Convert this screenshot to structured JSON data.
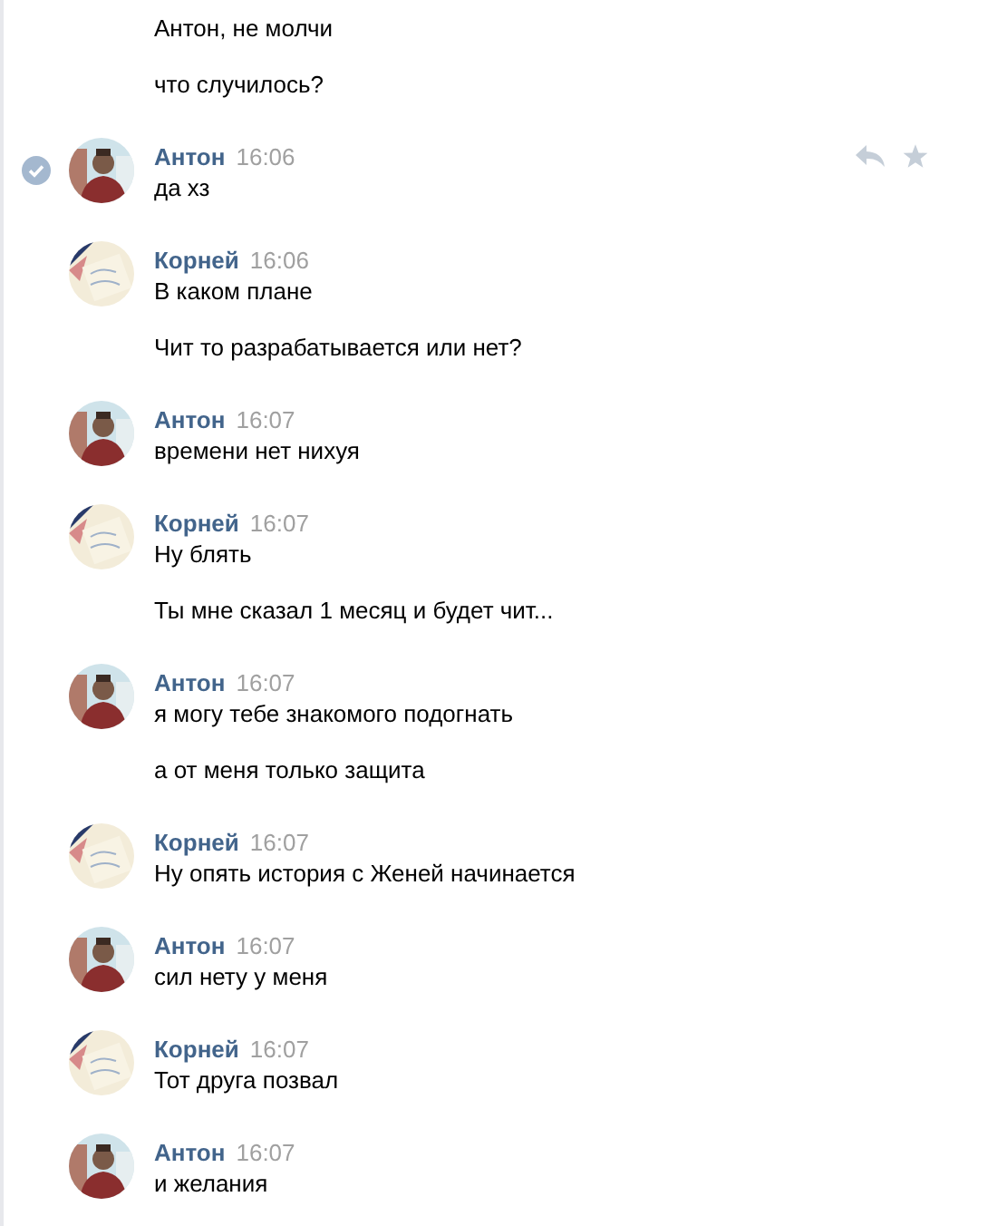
{
  "continuation": [
    "Антон, не молчи",
    "что случилось?"
  ],
  "groups": [
    {
      "author": "Антон",
      "time": "16:06",
      "selected": true,
      "messages": [
        "да хз"
      ]
    },
    {
      "author": "Корней",
      "time": "16:06",
      "selected": false,
      "messages": [
        "В каком плане",
        "Чит то разрабатывается или нет?"
      ]
    },
    {
      "author": "Антон",
      "time": "16:07",
      "selected": false,
      "messages": [
        "времени нет нихуя"
      ]
    },
    {
      "author": "Корней",
      "time": "16:07",
      "selected": false,
      "messages": [
        "Ну блять",
        "Ты мне сказал 1 месяц и будет чит..."
      ]
    },
    {
      "author": "Антон",
      "time": "16:07",
      "selected": false,
      "messages": [
        "я могу тебе знакомого подогнать",
        "а от меня только защита"
      ]
    },
    {
      "author": "Корней",
      "time": "16:07",
      "selected": false,
      "messages": [
        "Ну опять история с Женей начинается"
      ]
    },
    {
      "author": "Антон",
      "time": "16:07",
      "selected": false,
      "messages": [
        "сил нету у меня"
      ]
    },
    {
      "author": "Корней",
      "time": "16:07",
      "selected": false,
      "messages": [
        "Тот друга позвал"
      ]
    },
    {
      "author": "Антон",
      "time": "16:07",
      "selected": false,
      "messages": [
        "и желания"
      ]
    }
  ]
}
